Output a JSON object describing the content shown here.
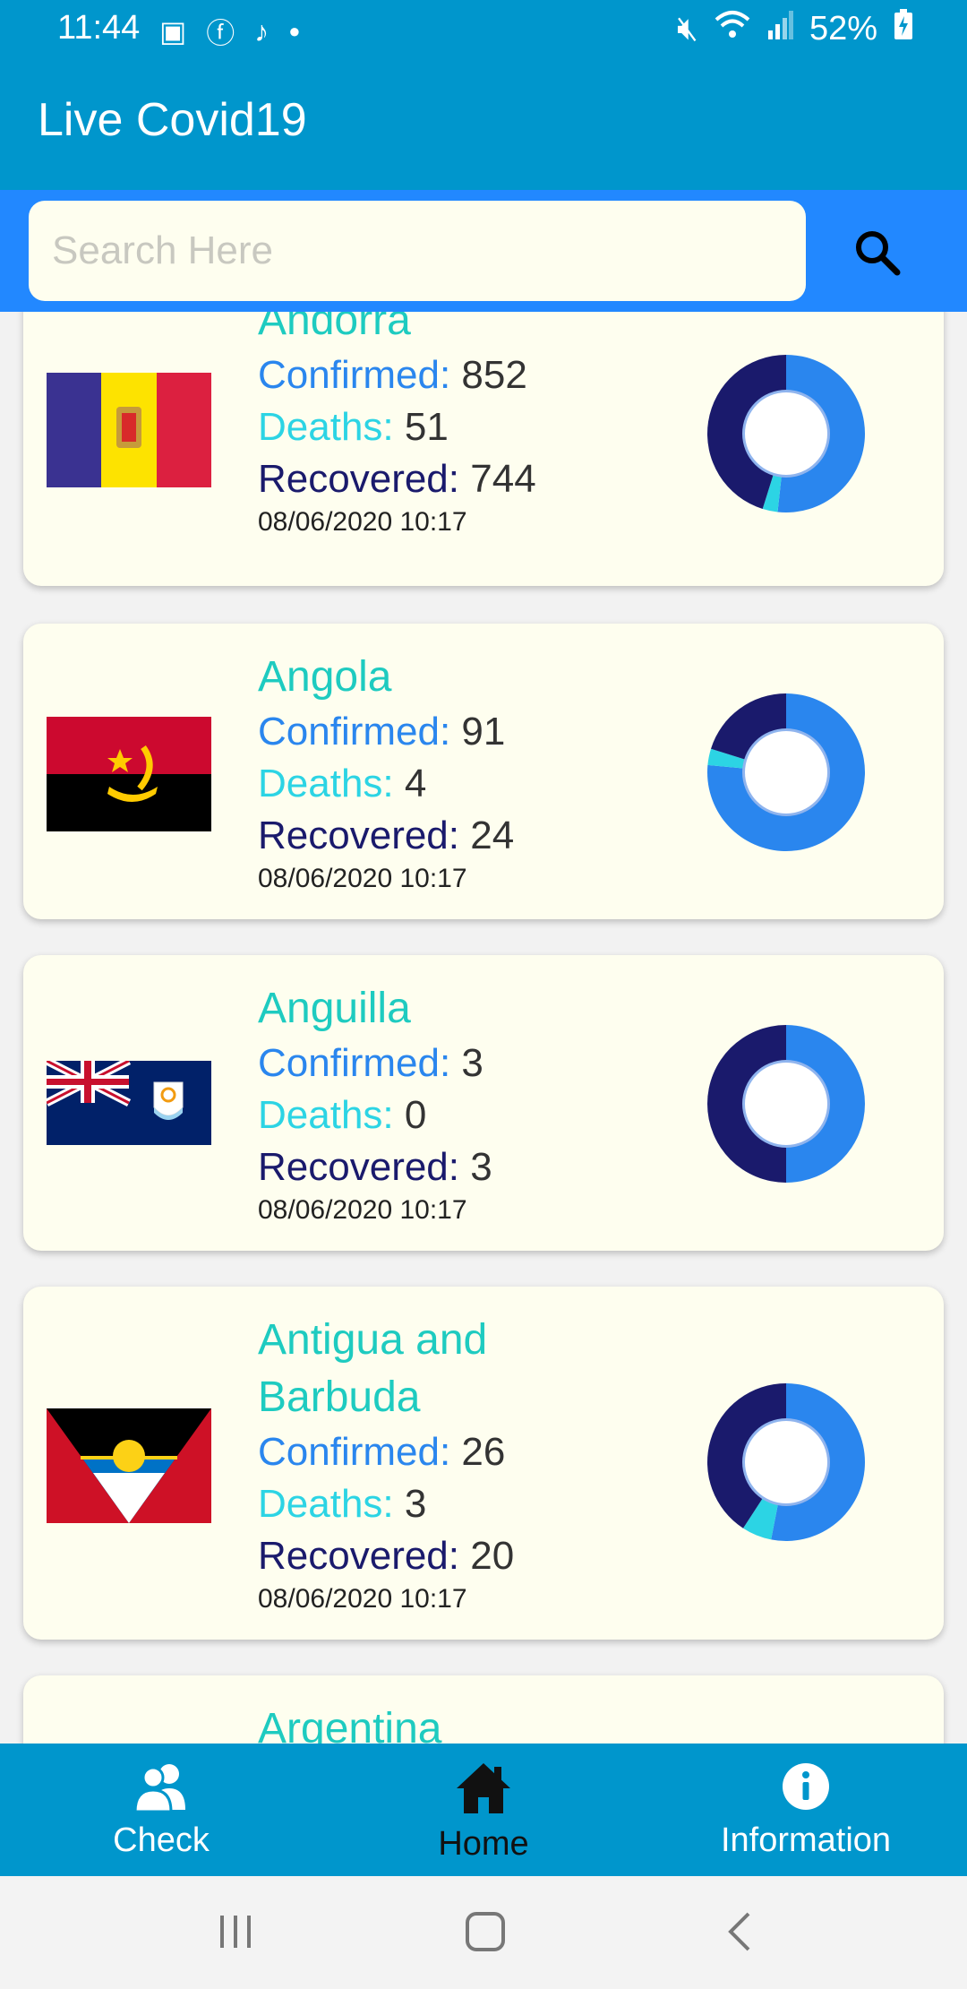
{
  "status_bar": {
    "time": "11:44",
    "battery": "52%",
    "notif_icons": [
      "linkedin-icon",
      "facebook-icon",
      "tiktok-icon",
      "dot-icon"
    ]
  },
  "app": {
    "title": "Live Covid19"
  },
  "search": {
    "placeholder": "Search Here"
  },
  "labels": {
    "confirmed": "Confirmed:",
    "deaths": "Deaths:",
    "recovered": "Recovered:"
  },
  "colors": {
    "confirmed": "#2a86ee",
    "deaths": "#2cd4e4",
    "recovered": "#1a1a6c",
    "app_bar": "#0096cc",
    "search_bar": "#2288ff"
  },
  "countries": [
    {
      "name": "Andorra",
      "confirmed": "852",
      "deaths": "51",
      "recovered": "744",
      "date": "08/06/2020 10:17",
      "flag": "andorra-flag"
    },
    {
      "name": "Angola",
      "confirmed": "91",
      "deaths": "4",
      "recovered": "24",
      "date": "08/06/2020 10:17",
      "flag": "angola-flag"
    },
    {
      "name": "Anguilla",
      "confirmed": "3",
      "deaths": "0",
      "recovered": "3",
      "date": "08/06/2020 10:17",
      "flag": "anguilla-flag"
    },
    {
      "name_line1": "Antigua and",
      "name_line2": "Barbuda",
      "confirmed": "26",
      "deaths": "3",
      "recovered": "20",
      "date": "08/06/2020 10:17",
      "flag": "antigua-flag"
    },
    {
      "name": "Argentina"
    }
  ],
  "bottom_nav": [
    {
      "label": "Check",
      "icon": "people-icon"
    },
    {
      "label": "Home",
      "icon": "home-icon",
      "active": true
    },
    {
      "label": "Information",
      "icon": "info-icon"
    }
  ]
}
